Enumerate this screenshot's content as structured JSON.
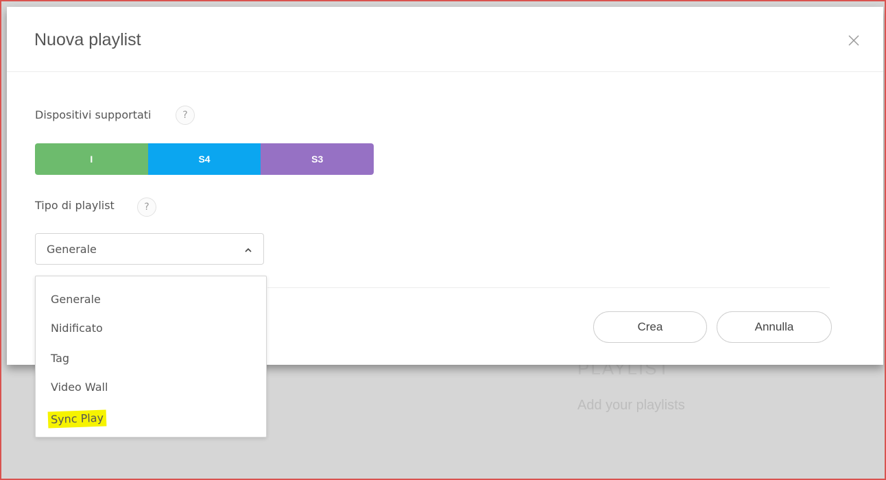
{
  "background": {
    "title": "PLAYLIST",
    "subtitle": "Add your playlists"
  },
  "modal": {
    "title": "Nuova playlist",
    "close_icon": "close-icon",
    "devices": {
      "label": "Dispositivi supportati",
      "help": "?",
      "segments": [
        {
          "label": "I",
          "color": "#6dbb6d"
        },
        {
          "label": "S4",
          "color": "#0ba6f0"
        },
        {
          "label": "S3",
          "color": "#9671c4"
        }
      ]
    },
    "playlist_type": {
      "label": "Tipo di playlist",
      "help": "?",
      "selected": "Generale",
      "caret_icon": "chevron-up-icon",
      "options": [
        "Generale",
        "Nidificato",
        "Tag",
        "Video Wall",
        "Sync Play"
      ],
      "highlighted_option": "Sync Play",
      "highlight_color": "#f6f300"
    },
    "buttons": {
      "create": "Crea",
      "cancel": "Annulla"
    }
  }
}
